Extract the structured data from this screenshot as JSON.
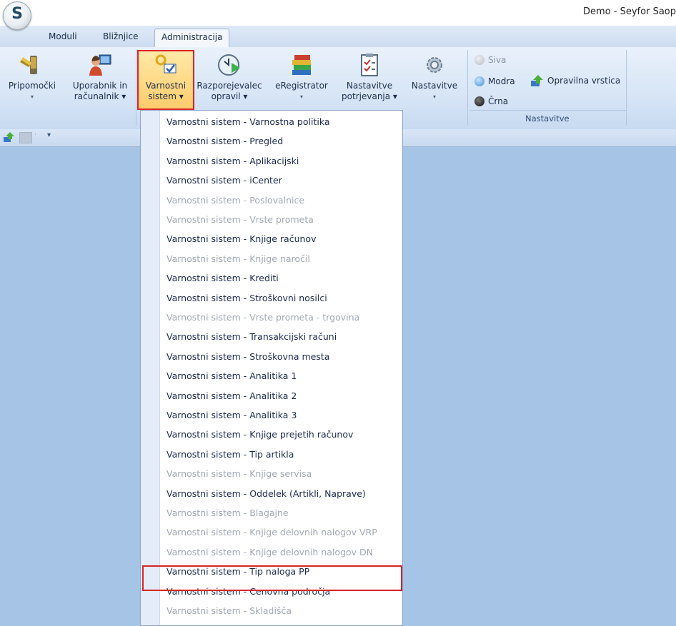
{
  "window": {
    "title": "Demo - Seyfor Saop",
    "logo_letter": "S"
  },
  "tabs": [
    {
      "label": "Moduli",
      "active": false
    },
    {
      "label": "Bližnjice",
      "active": false
    },
    {
      "label": "Administracija",
      "active": true
    }
  ],
  "ribbon": {
    "buttons": [
      {
        "line1": "Pripomočki",
        "line2": "▾",
        "icon": "tools-icon"
      },
      {
        "line1": "Uporabnik in",
        "line2": "računalnik ▾",
        "icon": "user-computer-icon"
      },
      {
        "line1": "Varnostni",
        "line2": "sistem ▾",
        "icon": "security-keys-icon",
        "highlighted": true
      },
      {
        "line1": "Razporejevalec",
        "line2": "opravil ▾",
        "icon": "scheduler-clock-icon"
      },
      {
        "line1": "eRegistrator",
        "line2": "▾",
        "icon": "books-icon"
      },
      {
        "line1": "Nastavitve",
        "line2": "potrjevanja ▾",
        "icon": "checklist-icon"
      },
      {
        "line1": "Nastavitve",
        "line2": "▾",
        "icon": "gear-icon"
      }
    ],
    "themes": [
      {
        "label": "Siva",
        "color": "#b7bcc2",
        "enabled": false
      },
      {
        "label": "Modra",
        "color": "#3f8fd6",
        "enabled": true
      },
      {
        "label": "Črna",
        "color": "#222222",
        "enabled": true
      }
    ],
    "toolbar_button": "Opravilna vrstica",
    "group_label": "Nastavitve"
  },
  "menu": {
    "items": [
      {
        "label": "Varnostni sistem - Varnostna politika",
        "enabled": true
      },
      {
        "label": "Varnostni sistem - Pregled",
        "enabled": true
      },
      {
        "label": "Varnostni sistem - Aplikacijski",
        "enabled": true
      },
      {
        "label": "Varnostni sistem - iCenter",
        "enabled": true
      },
      {
        "label": "Varnostni sistem - Poslovalnice",
        "enabled": false
      },
      {
        "label": "Varnostni sistem - Vrste prometa",
        "enabled": false
      },
      {
        "label": "Varnostni sistem - Knjige računov",
        "enabled": true
      },
      {
        "label": "Varnostni sistem - Knjige naročil",
        "enabled": false
      },
      {
        "label": "Varnostni sistem - Krediti",
        "enabled": true
      },
      {
        "label": "Varnostni sistem - Stroškovni nosilci",
        "enabled": true
      },
      {
        "label": "Varnostni sistem - Vrste prometa - trgovina",
        "enabled": false
      },
      {
        "label": "Varnostni sistem - Transakcijski računi",
        "enabled": true
      },
      {
        "label": "Varnostni sistem - Stroškovna mesta",
        "enabled": true
      },
      {
        "label": "Varnostni sistem - Analitika 1",
        "enabled": true
      },
      {
        "label": "Varnostni sistem - Analitika 2",
        "enabled": true
      },
      {
        "label": "Varnostni sistem - Analitika 3",
        "enabled": true
      },
      {
        "label": "Varnostni sistem - Knjige prejetih računov",
        "enabled": true
      },
      {
        "label": "Varnostni sistem - Tip artikla",
        "enabled": true
      },
      {
        "label": "Varnostni sistem - Knjige servisa",
        "enabled": false
      },
      {
        "label": "Varnostni sistem - Oddelek (Artikli, Naprave)",
        "enabled": true
      },
      {
        "label": "Varnostni sistem - Blagajne",
        "enabled": false
      },
      {
        "label": "Varnostni sistem - Knjige delovnih nalogov VRP",
        "enabled": false
      },
      {
        "label": "Varnostni sistem - Knjige delovnih nalogov DN",
        "enabled": false
      },
      {
        "label": "Varnostni sistem - Tip naloga PP",
        "enabled": true,
        "highlighted": true
      },
      {
        "label": "Varnostni sistem - Cenovna področja",
        "enabled": true
      },
      {
        "label": "Varnostni sistem - Skladišča",
        "enabled": false
      }
    ]
  }
}
